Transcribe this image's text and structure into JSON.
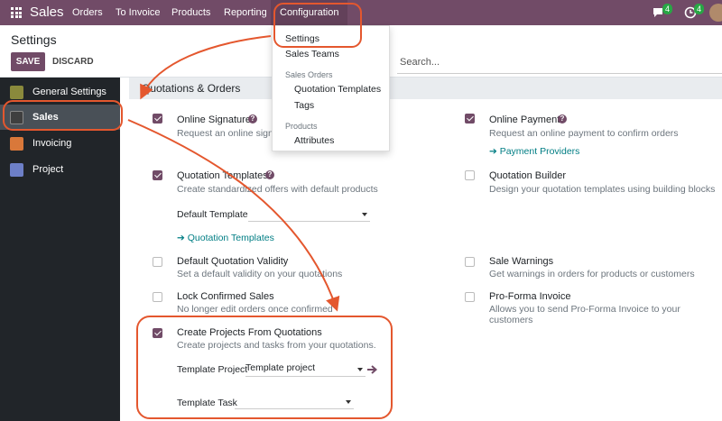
{
  "topbar": {
    "app_name": "Sales",
    "menus": [
      "Orders",
      "To Invoice",
      "Products",
      "Reporting",
      "Configuration"
    ],
    "messages_count": "4",
    "activities_count": "4"
  },
  "control_panel": {
    "title": "Settings",
    "save_label": "SAVE",
    "discard_label": "DISCARD",
    "search_placeholder": "Search..."
  },
  "config_menu": {
    "settings": "Settings",
    "sales_teams": "Sales Teams",
    "sales_orders_header": "Sales Orders",
    "quotation_templates": "Quotation Templates",
    "tags": "Tags",
    "products_header": "Products",
    "attributes": "Attributes"
  },
  "sidebar": {
    "items": [
      "General Settings",
      "Sales",
      "Invoicing",
      "Project"
    ]
  },
  "section": {
    "title": "Quotations & Orders"
  },
  "settings": {
    "online_signature": {
      "title": "Online Signature",
      "desc": "Request an online signature",
      "checked": true
    },
    "online_payment": {
      "title": "Online Payment",
      "desc": "Request an online payment to confirm orders",
      "link": "Payment Providers",
      "checked": true
    },
    "quotation_templates": {
      "title": "Quotation Templates",
      "desc": "Create standardized offers with default products",
      "field_label": "Default Template",
      "field_value": "",
      "link": "Quotation Templates",
      "checked": true
    },
    "quotation_builder": {
      "title": "Quotation Builder",
      "desc": "Design your quotation templates using building blocks",
      "checked": false
    },
    "default_validity": {
      "title": "Default Quotation Validity",
      "desc": "Set a default validity on your quotations",
      "checked": false
    },
    "sale_warnings": {
      "title": "Sale Warnings",
      "desc": "Get warnings in orders for products or customers",
      "checked": false
    },
    "lock_confirmed": {
      "title": "Lock Confirmed Sales",
      "desc": "No longer edit orders once confirmed",
      "checked": false
    },
    "pro_forma": {
      "title": "Pro-Forma Invoice",
      "desc": "Allows you to send Pro-Forma Invoice to your customers",
      "checked": false
    },
    "create_projects": {
      "title": "Create Projects From Quotations",
      "desc": "Create projects and tasks from your quotations.",
      "project_label": "Template Project",
      "project_value": "Template project",
      "task_label": "Template Task",
      "task_value": "",
      "checked": true
    }
  },
  "colors": {
    "primary": "#714b67",
    "link": "#017e84",
    "annotation": "#e4572e",
    "sidebar": "#212529"
  }
}
